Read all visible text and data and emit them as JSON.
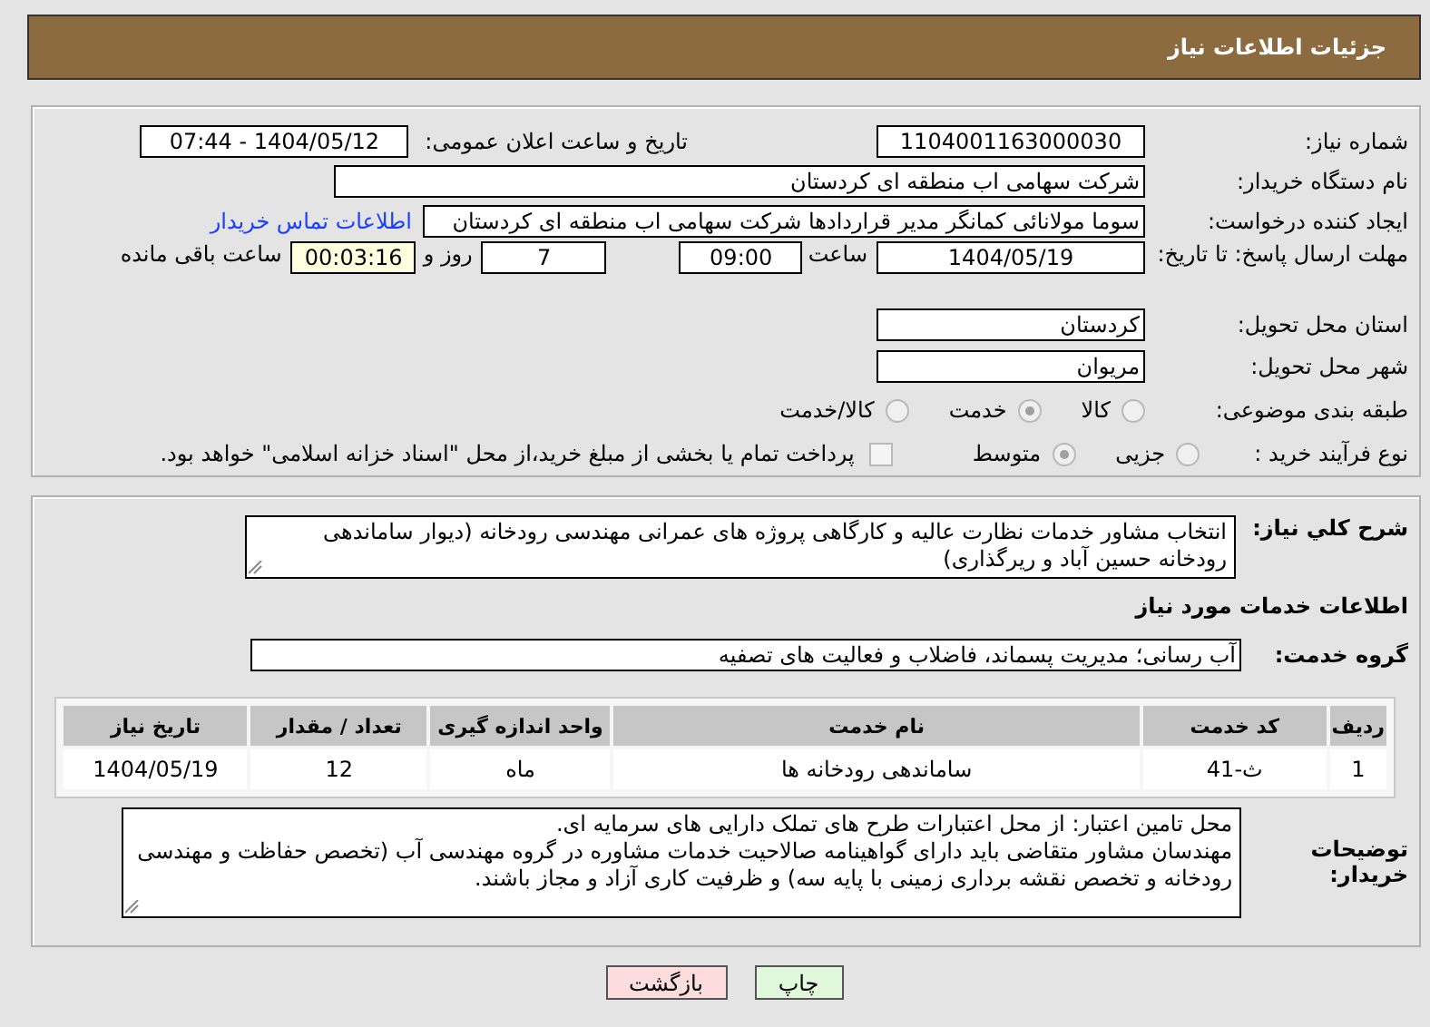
{
  "header": {
    "title": "جزئیات اطلاعات نیاز"
  },
  "need_number": {
    "label": "شماره نیاز:",
    "value": "1104001163000030"
  },
  "announce": {
    "label": "تاریخ و ساعت اعلان عمومی:",
    "value": "1404/05/12 - 07:44"
  },
  "buyer": {
    "label": "نام دستگاه خریدار:",
    "value": "شرکت سهامی اب منطقه ای کردستان"
  },
  "creator": {
    "label": "ایجاد کننده درخواست:",
    "value": "سوما مولانائی کمانگر مدیر قراردادها شرکت سهامی اب منطقه ای کردستان",
    "link": "اطلاعات تماس خریدار"
  },
  "deadline": {
    "label": "مهلت ارسال پاسخ: تا تاریخ:",
    "date": "1404/05/19",
    "time_label": "ساعت",
    "time": "09:00",
    "days": "7",
    "days_label": "روز و",
    "remaining": "00:03:16",
    "remaining_label": "ساعت باقی مانده"
  },
  "province": {
    "label": "استان محل تحویل:",
    "value": "کردستان"
  },
  "city": {
    "label": "شهر محل تحویل:",
    "value": "مریوان"
  },
  "category": {
    "label": "طبقه بندی موضوعی:",
    "options": [
      {
        "label": "کالا",
        "selected": false
      },
      {
        "label": "خدمت",
        "selected": true
      },
      {
        "label": "کالا/خدمت",
        "selected": false
      }
    ]
  },
  "process": {
    "label": "نوع فرآیند خرید :",
    "options": [
      {
        "label": "جزیی",
        "selected": false
      },
      {
        "label": "متوسط",
        "selected": true
      }
    ],
    "payment": {
      "checked": false,
      "text": "پرداخت تمام یا بخشی از مبلغ خرید،از محل \"اسناد خزانه اسلامی\" خواهد بود."
    }
  },
  "description": {
    "label": "شرح کلي نیاز:",
    "value": "انتخاب مشاور خدمات نظارت عالیه و کارگاهی پروژه های عمرانی مهندسی رودخانه (دیوار ساماندهی رودخانه حسین آباد و ریرگذاری)"
  },
  "services_heading": "اطلاعات خدمات مورد نیاز",
  "service_group": {
    "label": "گروه خدمت:",
    "value": "آب رسانی؛ مدیریت پسماند، فاضلاب و فعالیت های تصفیه"
  },
  "table": {
    "columns": [
      "ردیف",
      "کد خدمت",
      "نام خدمت",
      "واحد اندازه گیری",
      "تعداد / مقدار",
      "تاریخ نیاز"
    ],
    "rows": [
      [
        "1",
        "ث-41",
        "ساماندهی رودخانه ها",
        "ماه",
        "12",
        "1404/05/19"
      ]
    ]
  },
  "buyer_notes": {
    "label": "توضیحات خریدار:",
    "value": "محل تامین اعتبار: از محل اعتبارات طرح های تملک دارایی های سرمایه ای.\nمهندسان مشاور متقاضی باید دارای گواهینامه صالاحیت خدمات مشاوره در گروه مهندسی آب (تخصص حفاظت و مهندسی رودخانه و تخصص نقشه برداری زمینی با پایه سه) و ظرفیت کاری آزاد و مجاز باشند."
  },
  "buttons": [
    {
      "label": "چاپ",
      "kind": "print"
    },
    {
      "label": "بازگشت",
      "kind": "back"
    }
  ]
}
